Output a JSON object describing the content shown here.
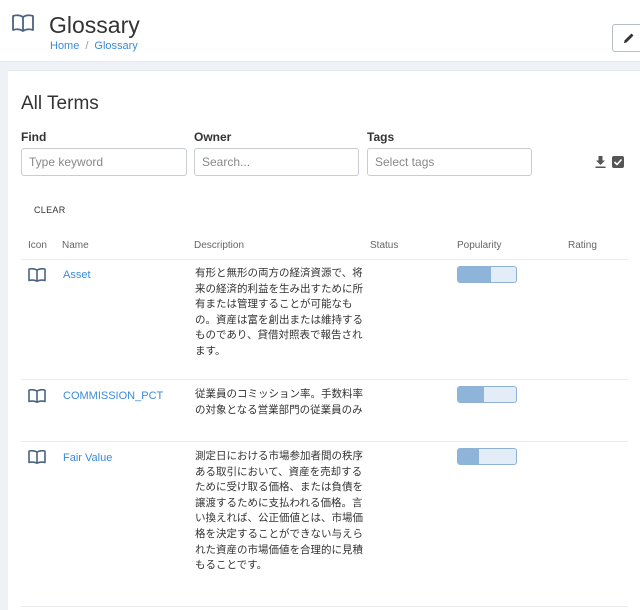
{
  "header": {
    "title": "Glossary",
    "breadcrumb": {
      "home": "Home",
      "separator": "/",
      "current": "Glossary"
    }
  },
  "section": {
    "title": "All Terms"
  },
  "filters": {
    "find": {
      "label": "Find",
      "placeholder": "Type keyword"
    },
    "owner": {
      "label": "Owner",
      "placeholder": "Search..."
    },
    "tags": {
      "label": "Tags",
      "placeholder": "Select tags"
    },
    "clear_label": "CLEAR"
  },
  "table": {
    "columns": {
      "icon": "Icon",
      "name": "Name",
      "description": "Description",
      "status": "Status",
      "popularity": "Popularity",
      "rating": "Rating"
    },
    "rows": [
      {
        "name": "Asset",
        "description": "有形と無形の両方の経済資源で、将来の経済的利益を生み出すために所有または管理することが可能なもの。資産は富を創出または維持するものであり、貸借対照表で報告されます。",
        "status": "",
        "popularity": 0.57,
        "rating": ""
      },
      {
        "name": "COMMISSION_PCT",
        "description": "従業員のコミッション率。手数料率の対象となる営業部門の従業員のみ",
        "status": "",
        "popularity": 0.45,
        "rating": ""
      },
      {
        "name": "Fair Value",
        "description": "測定日における市場参加者間の秩序ある取引において、資産を売却するために受け取る価格、または負債を譲渡するために支払われる価格。言い換えれば、公正価値とは、市場価格を決定することができない与えられた資産の市場価値を合理的に見積もることです。",
        "status": "",
        "popularity": 0.37,
        "rating": ""
      }
    ]
  },
  "colors": {
    "link": "#3b8ad9",
    "popularity_fill": "#8eb4d9",
    "popularity_track": "#e3edf7"
  },
  "icons": {
    "term": "book-icon",
    "edit": "pencil-icon",
    "download": "download-icon",
    "select": "checkbox-icon"
  }
}
